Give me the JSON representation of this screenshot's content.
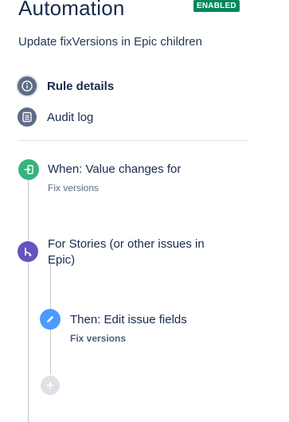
{
  "header": {
    "title": "Automation",
    "status_badge": "ENABLED",
    "rule_name": "Update fixVersions in Epic children"
  },
  "nav": {
    "items": [
      {
        "label": "Rule details",
        "icon": "info-icon",
        "active": true
      },
      {
        "label": "Audit log",
        "icon": "audit-log-icon",
        "active": false
      }
    ]
  },
  "flow": {
    "trigger": {
      "title": "When: Value changes for",
      "subtitle": "Fix versions",
      "icon": "trigger-icon",
      "color": "#36b37e"
    },
    "branch": {
      "title": "For Stories (or other issues in Epic)",
      "icon": "branch-icon",
      "color": "#6554c0"
    },
    "action": {
      "title": "Then: Edit issue fields",
      "subtitle": "Fix versions",
      "icon": "pencil-icon",
      "color": "#4c9aff"
    },
    "add": {
      "icon": "plus-icon"
    }
  },
  "colors": {
    "badge": "#00875a",
    "nav_icon": "#5e6c84",
    "connector": "#c1c7d0"
  }
}
